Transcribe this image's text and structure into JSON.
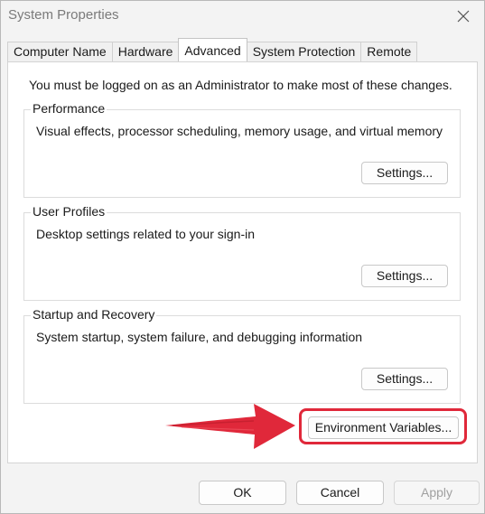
{
  "window": {
    "title": "System Properties"
  },
  "tabs": [
    {
      "label": "Computer Name"
    },
    {
      "label": "Hardware"
    },
    {
      "label": "Advanced",
      "active": true
    },
    {
      "label": "System Protection"
    },
    {
      "label": "Remote"
    }
  ],
  "notice": "You must be logged on as an Administrator to make most of these changes.",
  "groups": {
    "performance": {
      "title": "Performance",
      "description": "Visual effects, processor scheduling, memory usage, and virtual memory",
      "button": "Settings..."
    },
    "user_profiles": {
      "title": "User Profiles",
      "description": "Desktop settings related to your sign-in",
      "button": "Settings..."
    },
    "startup_recovery": {
      "title": "Startup and Recovery",
      "description": "System startup, system failure, and debugging information",
      "button": "Settings..."
    }
  },
  "environment_button": "Environment Variables...",
  "annotation": {
    "highlight_color": "#e0283a",
    "arrow_icon": "red-arrow-icon"
  },
  "footer": {
    "ok": "OK",
    "cancel": "Cancel",
    "apply": "Apply",
    "apply_enabled": false
  }
}
